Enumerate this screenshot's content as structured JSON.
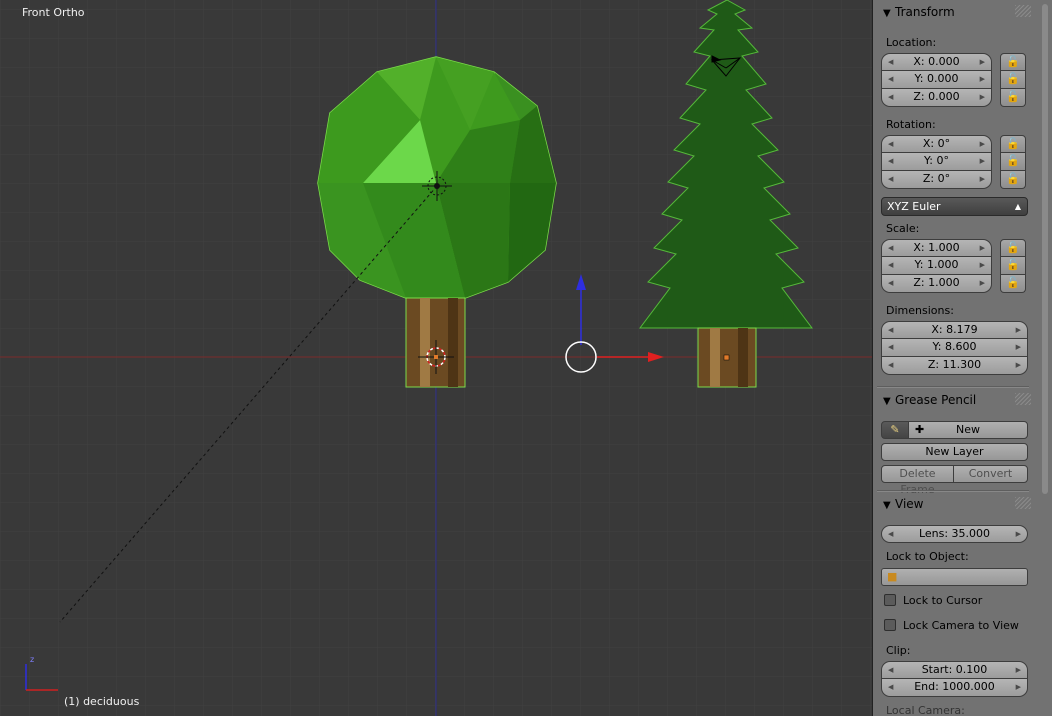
{
  "viewport": {
    "view_name": "Front Ortho",
    "object_label": "(1) deciduous",
    "axis_z": "z",
    "colors": {
      "background": "#393939",
      "x_axis": "#8a2b2b",
      "z_axis": "#2b2b8a",
      "foliage": "#3a9a1a",
      "pine": "#1f5a17",
      "trunk": "#6b4a22"
    }
  },
  "panel": {
    "transform": {
      "title": "Transform",
      "location_label": "Location:",
      "location": [
        "X: 0.000",
        "Y: 0.000",
        "Z: 0.000"
      ],
      "rotation_label": "Rotation:",
      "rotation": [
        "X: 0°",
        "Y: 0°",
        "Z: 0°"
      ],
      "rotation_mode": "XYZ Euler",
      "scale_label": "Scale:",
      "scale": [
        "X: 1.000",
        "Y: 1.000",
        "Z: 1.000"
      ],
      "dimensions_label": "Dimensions:",
      "dimensions": [
        "X: 8.179",
        "Y: 8.600",
        "Z: 11.300"
      ]
    },
    "grease_pencil": {
      "title": "Grease Pencil",
      "new": "New",
      "new_layer": "New Layer",
      "delete_frame": "Delete Frame",
      "convert": "Convert"
    },
    "view": {
      "title": "View",
      "lens": "Lens: 35.000",
      "lock_to_object_label": "Lock to Object:",
      "lock_to_cursor": "Lock to Cursor",
      "lock_camera_to_view": "Lock Camera to View",
      "clip_label": "Clip:",
      "clip_start": "Start: 0.100",
      "clip_end": "End: 1000.000",
      "local_camera_label": "Local Camera:"
    }
  }
}
